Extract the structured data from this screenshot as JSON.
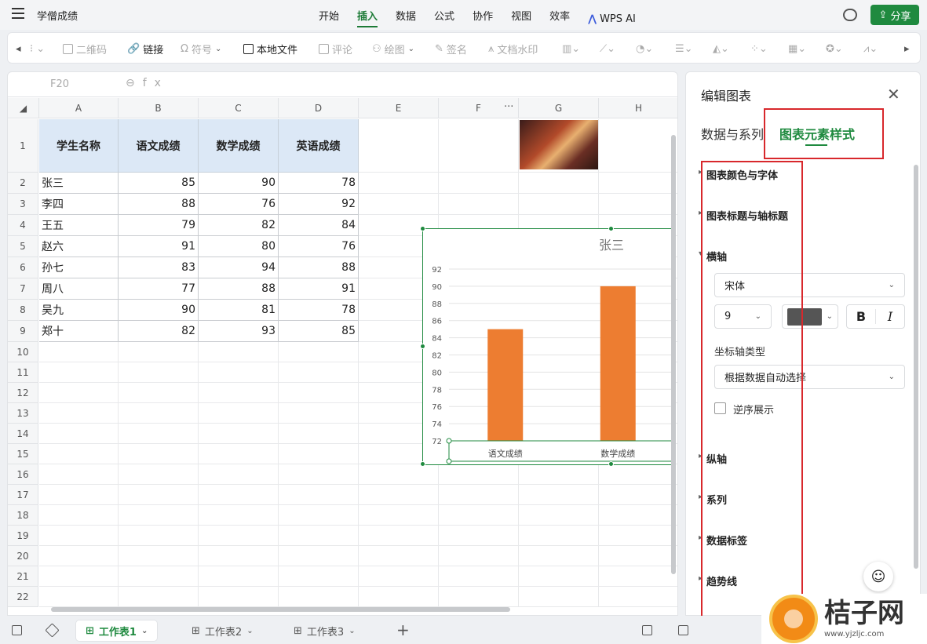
{
  "app": {
    "doc_title": "学僧成绩",
    "share_label": "分享"
  },
  "menu_tabs": [
    {
      "label": "开始"
    },
    {
      "label": "插入",
      "active": true
    },
    {
      "label": "数据"
    },
    {
      "label": "公式"
    },
    {
      "label": "协作"
    },
    {
      "label": "视图"
    },
    {
      "label": "效率"
    },
    {
      "label": "WPS AI"
    }
  ],
  "toolbar": {
    "items": [
      "二维码",
      "链接",
      "符号",
      "本地文件",
      "评论",
      "绘图",
      "签名",
      "文档水印"
    ]
  },
  "formula_bar": {
    "cell_ref": "F20",
    "fx": "fx"
  },
  "columns": [
    "A",
    "B",
    "C",
    "D",
    "E",
    "F",
    "G",
    "H"
  ],
  "col_more": "···",
  "rows": [
    "1",
    "2",
    "3",
    "4",
    "5",
    "6",
    "7",
    "8",
    "9",
    "10",
    "11",
    "12",
    "13",
    "14",
    "15",
    "16",
    "17",
    "18",
    "19",
    "20",
    "21",
    "22"
  ],
  "table": {
    "headers": [
      "学生名称",
      "语文成绩",
      "数学成绩",
      "英语成绩"
    ],
    "data": [
      [
        "张三",
        "85",
        "90",
        "78"
      ],
      [
        "李四",
        "88",
        "76",
        "92"
      ],
      [
        "王五",
        "79",
        "82",
        "84"
      ],
      [
        "赵六",
        "91",
        "80",
        "76"
      ],
      [
        "孙七",
        "83",
        "94",
        "88"
      ],
      [
        "周八",
        "77",
        "88",
        "91"
      ],
      [
        "吴九",
        "90",
        "81",
        "78"
      ],
      [
        "郑十",
        "82",
        "93",
        "85"
      ]
    ]
  },
  "chart_data": {
    "type": "bar",
    "title": "张三",
    "categories": [
      "语文成绩",
      "数学成绩"
    ],
    "values": [
      85,
      90
    ],
    "ylim": [
      72,
      92
    ],
    "yticks": [
      72,
      74,
      76,
      78,
      80,
      82,
      84,
      86,
      88,
      90,
      92
    ],
    "bar_color": "#ed7d31",
    "grid": true
  },
  "panel": {
    "title": "编辑图表",
    "tabs": [
      "数据与系列",
      "图表元素样式"
    ],
    "sections": {
      "color_font": "图表颜色与字体",
      "title_axis": "图表标题与轴标题",
      "h_axis": "横轴",
      "v_axis": "纵轴",
      "series": "系列",
      "data_labels": "数据标签",
      "trendline": "趋势线"
    },
    "font_name": "宋体",
    "font_size": "9",
    "font_color": "#555555",
    "bold": "B",
    "italic": "I",
    "axis_type_label": "坐标轴类型",
    "axis_type_value": "根据数据自动选择",
    "reverse_label": "逆序展示",
    "accent": "#1f8a3f",
    "highlight_color": "#d8282c"
  },
  "sheet_tabs": [
    {
      "label": "工作表1",
      "active": true
    },
    {
      "label": "工作表2"
    },
    {
      "label": "工作表3"
    }
  ],
  "watermark": {
    "main": "桔子网",
    "url": "www.yjzljc.com"
  }
}
